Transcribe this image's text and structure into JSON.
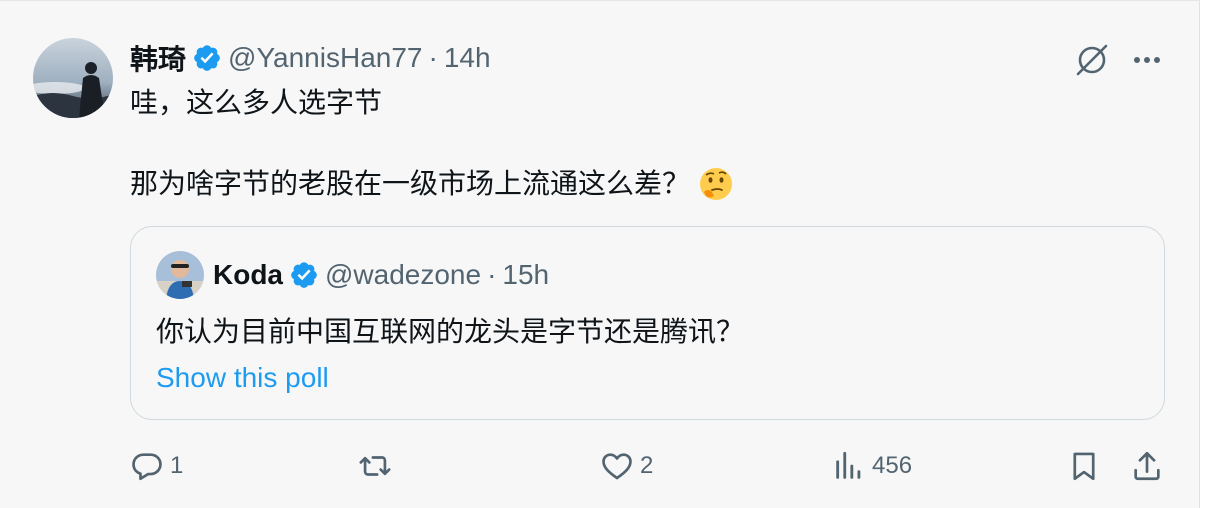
{
  "tweet": {
    "author_name": "韩琦",
    "handle": "@YannisHan77",
    "separator": "·",
    "time": "14h",
    "line1": "哇，这么多人选字节",
    "line2": "那为啥字节的老股在一级市场上流通这么差？",
    "emoji": "thinking-face"
  },
  "quote": {
    "author_name": "Koda",
    "handle": "@wadezone",
    "separator": "·",
    "time": "15h",
    "text": "你认为目前中国互联网的龙头是字节还是腾讯？",
    "poll_link": "Show this poll"
  },
  "actions": {
    "replies": "1",
    "retweets": "",
    "likes": "2",
    "views": "456"
  },
  "colors": {
    "verified": "#1d9bf0",
    "link": "#1d9bf0",
    "muted": "#536471",
    "background": "#f7f7f7"
  }
}
